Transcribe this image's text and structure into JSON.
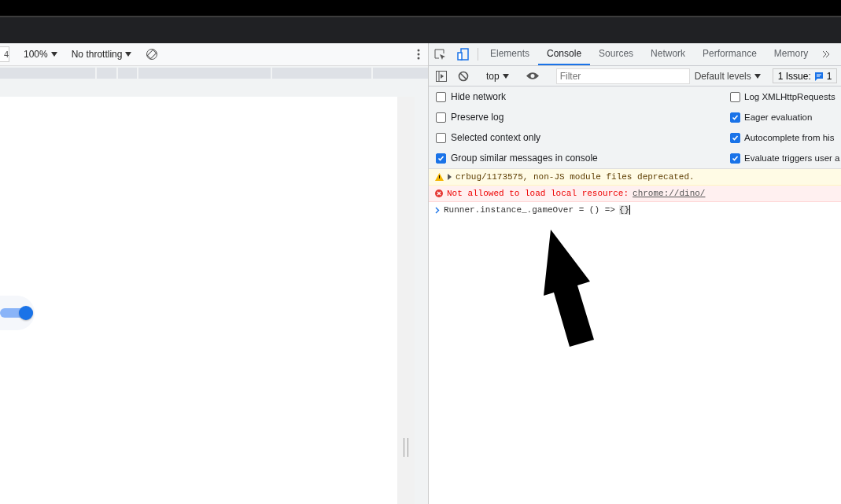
{
  "device_toolbar": {
    "width_value": "4",
    "zoom": "100%",
    "throttling": "No throttling"
  },
  "toggle": {
    "on": true
  },
  "devtools": {
    "tabs": [
      {
        "label": "Elements",
        "selected": false
      },
      {
        "label": "Console",
        "selected": true
      },
      {
        "label": "Sources",
        "selected": false
      },
      {
        "label": "Network",
        "selected": false
      },
      {
        "label": "Performance",
        "selected": false
      },
      {
        "label": "Memory",
        "selected": false
      }
    ],
    "context": "top",
    "filter": {
      "placeholder": "Filter"
    },
    "levels": "Default levels",
    "issues": {
      "label": "1 Issue:",
      "count": "1"
    },
    "settings_left": [
      {
        "label": "Hide network",
        "checked": false
      },
      {
        "label": "Preserve log",
        "checked": false
      },
      {
        "label": "Selected context only",
        "checked": false
      },
      {
        "label": "Group similar messages in console",
        "checked": true
      }
    ],
    "settings_right": [
      {
        "label": "Log XMLHttpRequests",
        "checked": false
      },
      {
        "label": "Eager evaluation",
        "checked": true
      },
      {
        "label": "Autocomplete from his",
        "checked": true
      },
      {
        "label": "Evaluate triggers user a",
        "checked": true
      }
    ],
    "messages": [
      {
        "kind": "warning",
        "text": "crbug/1173575, non-JS module files deprecated."
      },
      {
        "kind": "error",
        "text": "Not allowed to load local resource:",
        "link": "chrome://dino/"
      },
      {
        "kind": "input",
        "text": "Runner.instance_.gameOver = () =>",
        "braces": "{}"
      }
    ]
  }
}
